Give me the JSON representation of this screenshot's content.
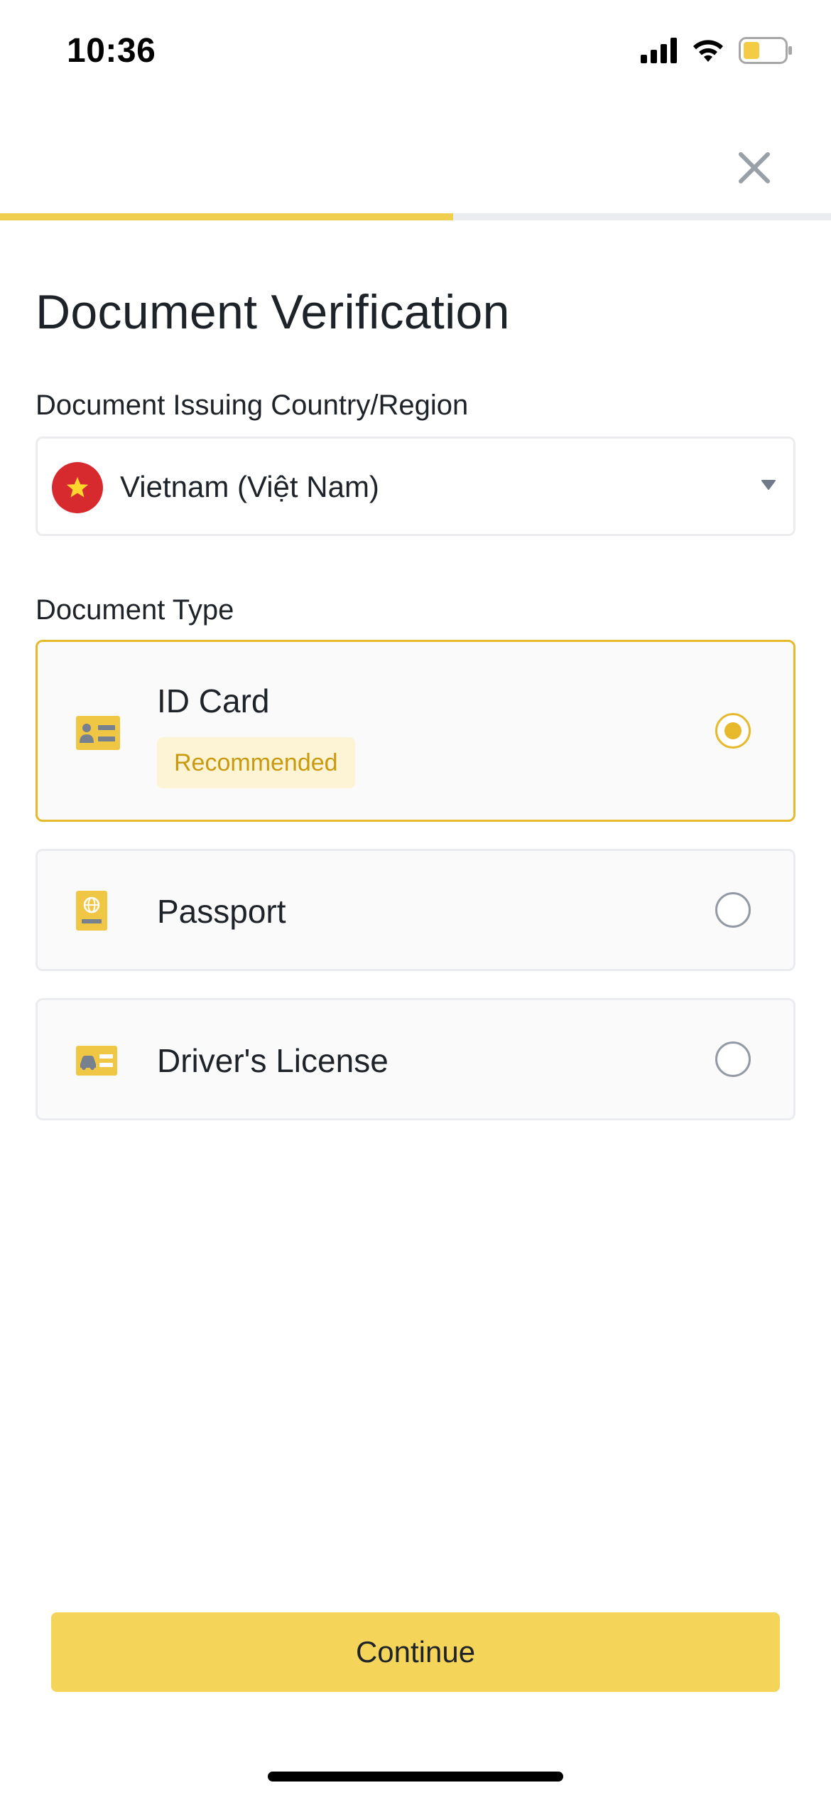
{
  "status_bar": {
    "time": "10:36",
    "icons": [
      "cellular-signal-icon",
      "wifi-icon",
      "battery-low-icon"
    ]
  },
  "header": {
    "close_icon": "close-icon",
    "progress_fraction": 0.545
  },
  "page": {
    "title": "Document Verification"
  },
  "country": {
    "label": "Document Issuing Country/Region",
    "selected_value": "Vietnam (Việt Nam)",
    "flag_icon": "vietnam-flag-icon",
    "caret_icon": "caret-down-icon"
  },
  "document_type": {
    "label": "Document Type",
    "selected_index": 0,
    "options": [
      {
        "label": "ID Card",
        "badge": "Recommended",
        "icon": "id-card-icon",
        "selected": true
      },
      {
        "label": "Passport",
        "icon": "passport-icon",
        "selected": false
      },
      {
        "label": "Driver's License",
        "icon": "drivers-license-icon",
        "selected": false
      }
    ]
  },
  "actions": {
    "continue_label": "Continue"
  },
  "colors": {
    "accent_yellow": "#F0CF4F",
    "button_yellow": "#F4D55A",
    "selected_border": "#E7B92D",
    "badge_bg": "#FDF4D6",
    "badge_text": "#C99A0E",
    "text_primary": "#1E2329",
    "border_gray": "#EAECEF",
    "flag_red": "#D62A2F"
  }
}
